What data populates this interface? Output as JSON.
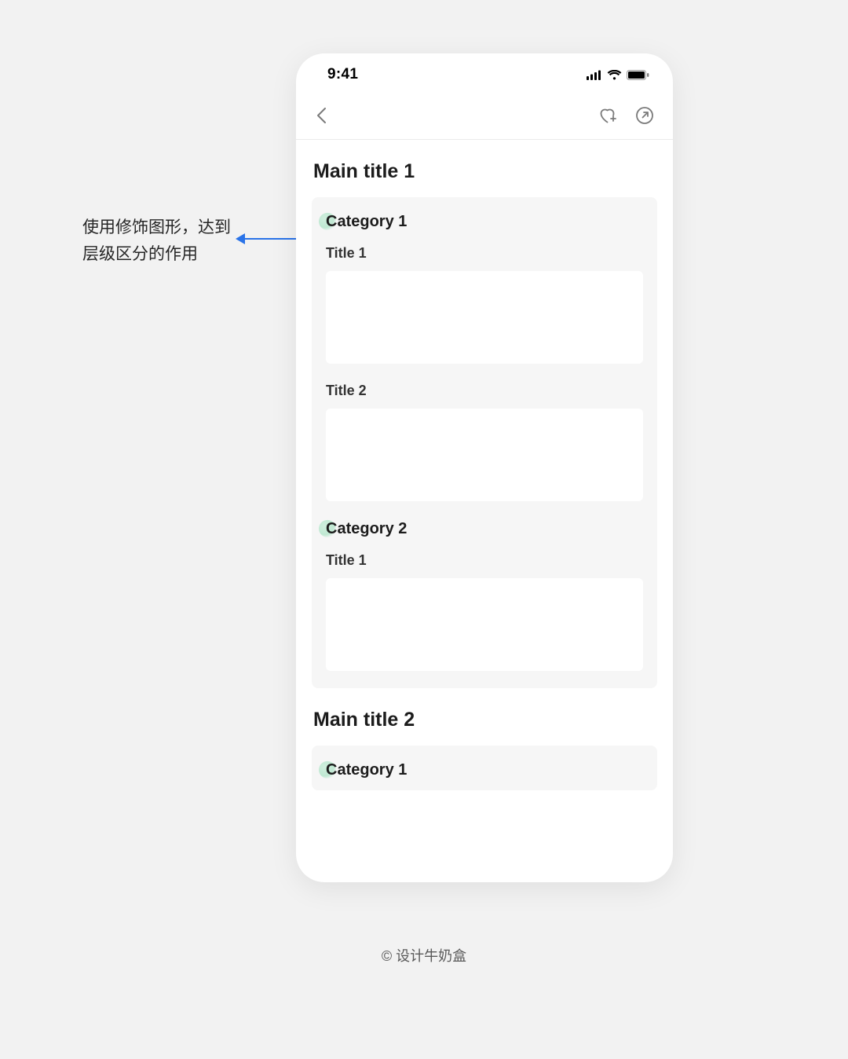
{
  "annotation": {
    "text": "使用修饰图形，达到层级区分的作用"
  },
  "status": {
    "time": "9:41"
  },
  "sections": [
    {
      "title": "Main title 1",
      "groups": [
        {
          "category": "Category 1",
          "items": [
            "Title 1",
            "Title 2"
          ]
        },
        {
          "category": "Category 2",
          "items": [
            "Title 1"
          ]
        }
      ]
    },
    {
      "title": "Main title 2",
      "groups": [
        {
          "category": "Category 1",
          "items": []
        }
      ]
    }
  ],
  "footer": {
    "caption": "© 设计牛奶盒"
  }
}
